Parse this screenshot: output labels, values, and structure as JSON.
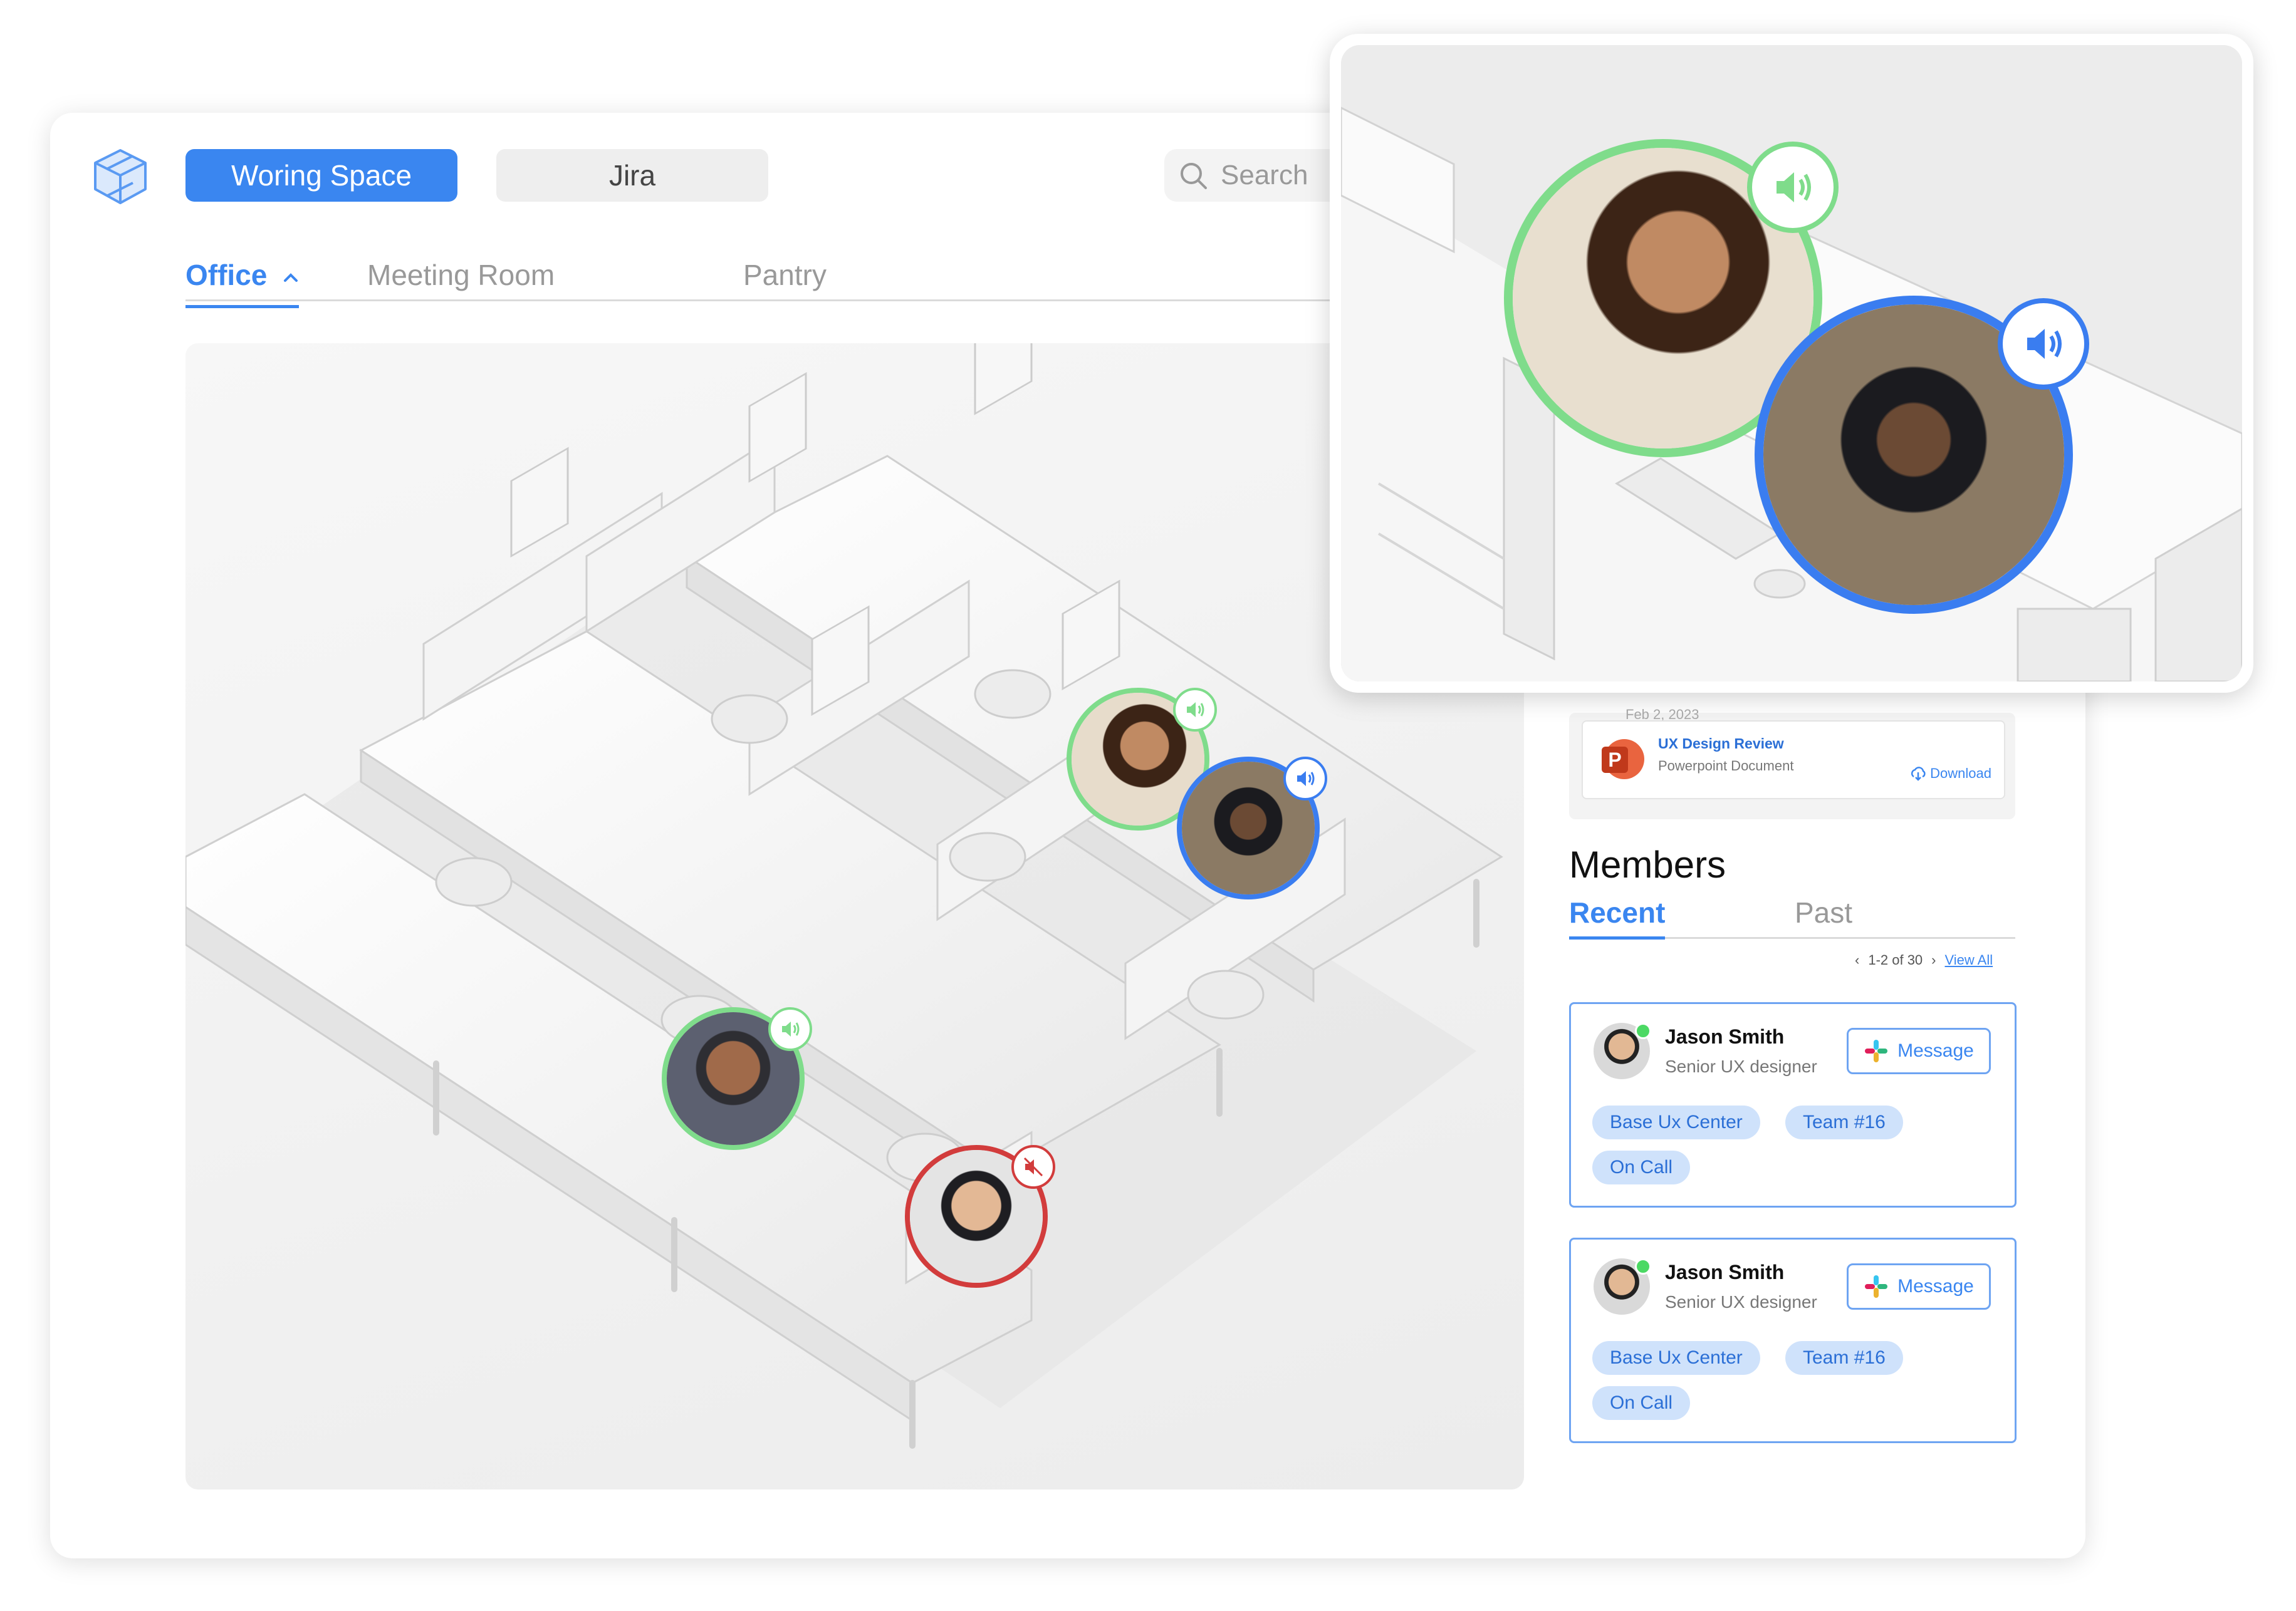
{
  "toolbar": {
    "workspace_label": "Woring Space",
    "jira_label": "Jira",
    "search_placeholder": "Search"
  },
  "tabs": {
    "office": "Office",
    "meeting_room": "Meeting Room",
    "pantry": "Pantry"
  },
  "file": {
    "date": "Feb 2, 2023",
    "title": "UX Design Review",
    "type": "Powerpoint Document",
    "download": "Download"
  },
  "members": {
    "title": "Members",
    "tab_recent": "Recent",
    "tab_past": "Past",
    "pager": "1-2 of 30",
    "view_all": "View All",
    "list": [
      {
        "name": "Jason Smith",
        "role": "Senior UX designer",
        "message": "Message",
        "tags": [
          "Base Ux Center",
          "Team #16",
          "On Call"
        ]
      },
      {
        "name": "Jason Smith",
        "role": "Senior UX designer",
        "message": "Message",
        "tags": [
          "Base Ux Center",
          "Team #16",
          "On Call"
        ]
      }
    ]
  },
  "colors": {
    "accent": "#3a86f0",
    "speaking": "#7fdc8b",
    "active_speaker": "#3a7df0",
    "muted": "#d23c3c"
  }
}
